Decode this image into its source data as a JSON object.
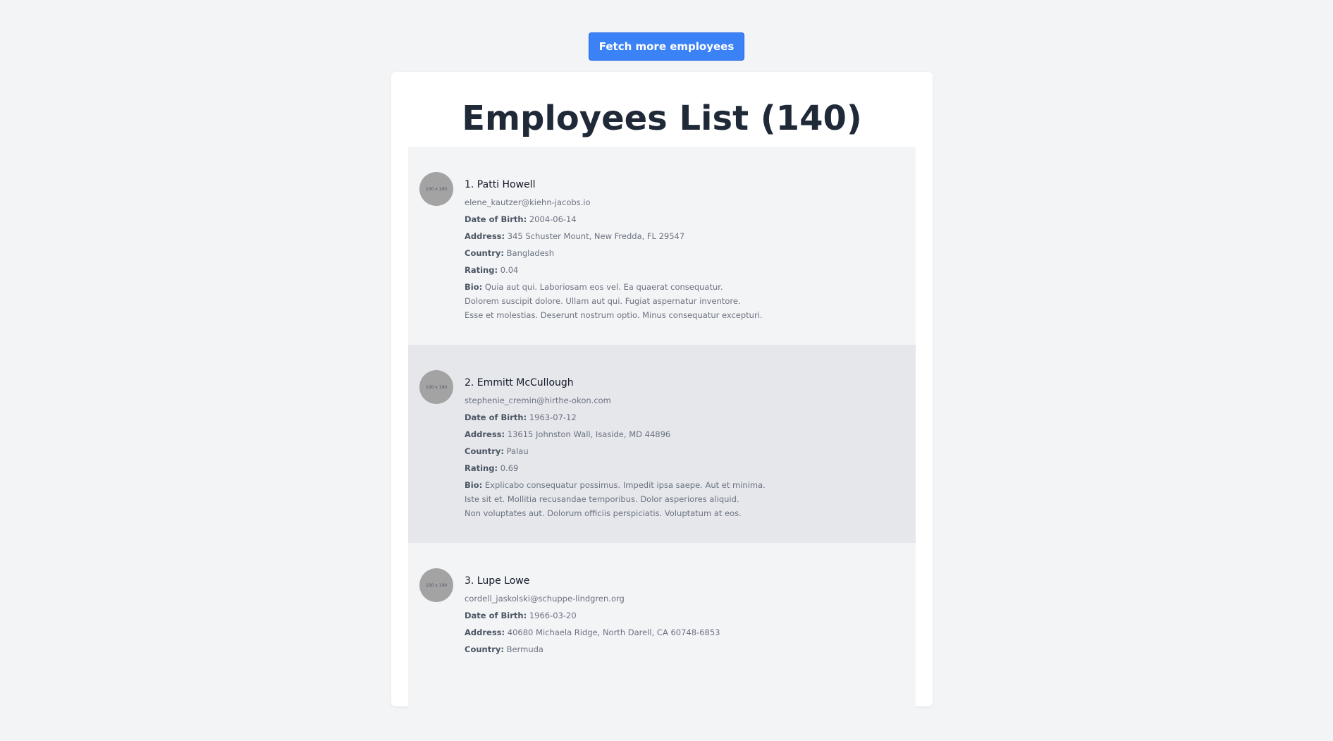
{
  "fetch_button": {
    "label": "Fetch more employees"
  },
  "title": "Employees List (140)",
  "labels": {
    "dob": "Date of Birth:",
    "address": "Address:",
    "country": "Country:",
    "rating": "Rating:",
    "bio": "Bio:",
    "avatar": "100 x 100"
  },
  "employees": [
    {
      "name": "1. Patti Howell",
      "email": "elene_kautzer@kiehn-jacobs.io",
      "dob": "2004-06-14",
      "address": "345 Schuster Mount, New Fredda, FL 29547",
      "country": "Bangladesh",
      "rating": "0.04",
      "bio": [
        "Quia aut qui. Laboriosam eos vel. Ea quaerat consequatur.",
        "Dolorem suscipit dolore. Ullam aut qui. Fugiat aspernatur inventore.",
        "Esse et molestias. Deserunt nostrum optio. Minus consequatur excepturi."
      ]
    },
    {
      "name": "2. Emmitt McCullough",
      "email": "stephenie_cremin@hirthe-okon.com",
      "dob": "1963-07-12",
      "address": "13615 Johnston Wall, Isaside, MD 44896",
      "country": "Palau",
      "rating": "0.69",
      "bio": [
        "Explicabo consequatur possimus. Impedit ipsa saepe. Aut et minima.",
        "Iste sit et. Mollitia recusandae temporibus. Dolor asperiores aliquid.",
        "Non voluptates aut. Dolorum officiis perspiciatis. Voluptatum at eos."
      ]
    },
    {
      "name": "3. Lupe Lowe",
      "email": "cordell_jaskolski@schuppe-lindgren.org",
      "dob": "1966-03-20",
      "address": "40680 Michaela Ridge, North Darell, CA 60748-6853",
      "country": "Bermuda",
      "rating": "",
      "bio": [
        "",
        "",
        ""
      ]
    }
  ]
}
